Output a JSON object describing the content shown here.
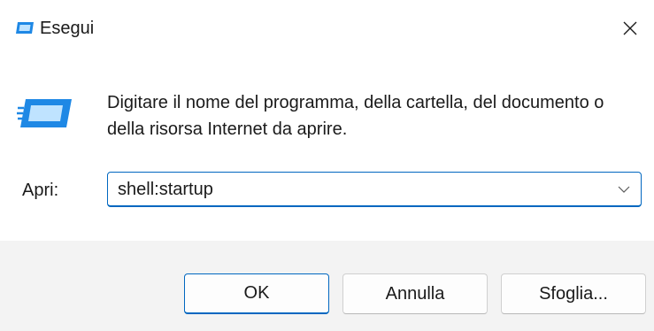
{
  "window": {
    "title": "Esegui",
    "icon": "run-dialog-icon",
    "close_icon": "close-icon"
  },
  "body": {
    "icon": "run-dialog-icon",
    "description": "Digitare il nome del programma, della cartella, del documento o della risorsa Internet da aprire."
  },
  "open_field": {
    "label": "Apri:",
    "value": "shell:startup",
    "dropdown_icon": "chevron-down-icon"
  },
  "buttons": {
    "ok": "OK",
    "cancel": "Annulla",
    "browse": "Sfoglia..."
  },
  "colors": {
    "accent": "#0067c0",
    "icon_blue": "#1e88e5",
    "footer_bg": "#f3f3f3"
  }
}
